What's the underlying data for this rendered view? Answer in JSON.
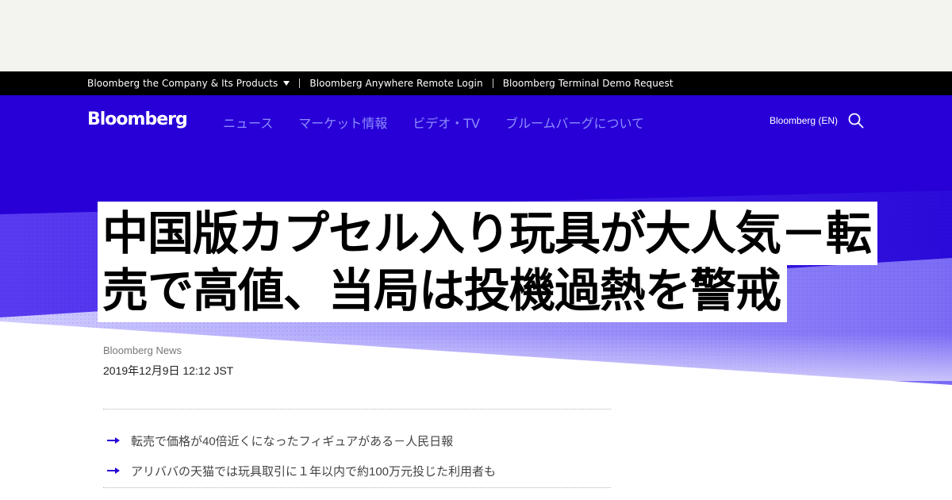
{
  "topbar": {
    "links": [
      "Bloomberg the Company & Its Products",
      "Bloomberg Anywhere Remote Login",
      "Bloomberg Terminal Demo Request"
    ]
  },
  "header": {
    "logo": "Bloomberg",
    "nav": [
      "ニュース",
      "マーケット情報",
      "ビデオ・TV",
      "ブルームバーグについて"
    ],
    "edition": "Bloomberg (EN)"
  },
  "article": {
    "headline": "中国版カプセル入り玩具が大人気－転売で高値、当局は投機過熱を警戒",
    "byline": "Bloomberg News",
    "date": "2019年12月9日 12:12 JST",
    "bullets": [
      "転売で価格が40倍近くになったフィギュアがある－人民日報",
      "アリババの天猫では玩具取引に１年以内で約100万元投じた利用者も"
    ]
  },
  "colors": {
    "brand_blue": "#2800d7",
    "nav_text": "#8c8cff",
    "arrow": "#2800d7"
  },
  "icons": {
    "caret": "caret-down-icon",
    "search": "search-icon",
    "bullet": "arrow-right-icon"
  }
}
